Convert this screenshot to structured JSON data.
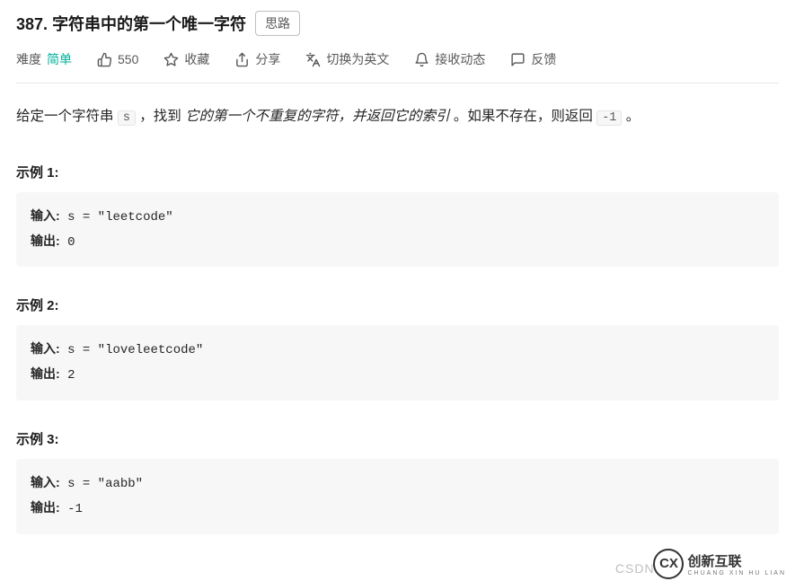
{
  "header": {
    "number": "387.",
    "title": "字符串中的第一个唯一字符",
    "hint_button": "思路"
  },
  "meta": {
    "difficulty_label": "难度",
    "difficulty_value": "简单",
    "like_count": "550",
    "favorite": "收藏",
    "share": "分享",
    "switch_lang": "切换为英文",
    "subscribe": "接收动态",
    "feedback": "反馈"
  },
  "description": {
    "pre": "给定一个字符串 ",
    "code1": "s",
    "mid1": " ，找到 ",
    "italic": "它的第一个不重复的字符，并返回它的索引",
    "mid2": " 。如果不存在，则返回 ",
    "code2": "-1",
    "tail": " 。"
  },
  "examples": [
    {
      "title": "示例 1:",
      "input_label": "输入:",
      "input_value": " s = \"leetcode\"",
      "output_label": "输出:",
      "output_value": " 0"
    },
    {
      "title": "示例 2:",
      "input_label": "输入:",
      "input_value": " s = \"loveleetcode\"",
      "output_label": "输出:",
      "output_value": " 2"
    },
    {
      "title": "示例 3:",
      "input_label": "输入:",
      "input_value": " s = \"aabb\"",
      "output_label": "输出:",
      "output_value": " -1"
    }
  ],
  "watermark": {
    "csdn": "CSDN",
    "cx_badge": "CX",
    "cx_text": "创新互联",
    "cx_sub": "CHUANG XIN HU LIAN"
  }
}
